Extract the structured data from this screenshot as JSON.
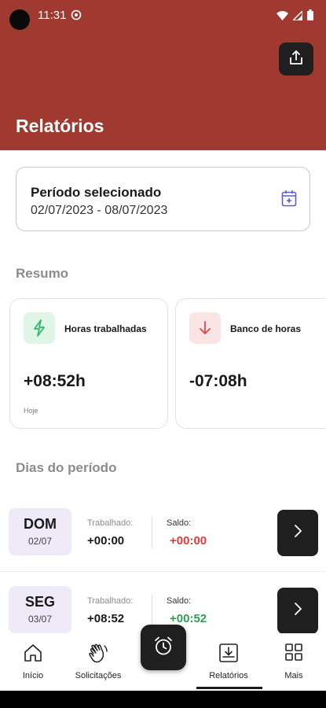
{
  "status_bar": {
    "time": "11:31"
  },
  "header": {
    "title": "Relatórios"
  },
  "period": {
    "label": "Período selecionado",
    "value": "02/07/2023 - 08/07/2023"
  },
  "summary": {
    "title": "Resumo",
    "cards": [
      {
        "label": "Horas trabalhadas",
        "value": "+08:52h",
        "caption": "Hoje",
        "icon": "lightning-icon",
        "icon_bg": "#dff5e6",
        "icon_color": "#2fb86a"
      },
      {
        "label": "Banco de horas",
        "value": "-07:08h",
        "caption": "",
        "icon": "arrow-down-icon",
        "icon_bg": "#fbe4e4",
        "icon_color": "#e04848"
      }
    ]
  },
  "days": {
    "title": "Dias do período",
    "worked_label": "Trabalhado:",
    "balance_label": "Saldo:",
    "rows": [
      {
        "day": "DOM",
        "date": "02/07",
        "worked": "+00:00",
        "balance": "+00:00",
        "balance_color": "#e53935"
      },
      {
        "day": "SEG",
        "date": "03/07",
        "worked": "+08:52",
        "balance": "+00:52",
        "balance_color": "#2e9e4f"
      }
    ]
  },
  "nav": {
    "items": [
      {
        "label": "Início",
        "icon": "home-icon"
      },
      {
        "label": "Solicitações",
        "icon": "hand-wave-icon"
      },
      {
        "label": "Relatórios",
        "icon": "download-tray-icon"
      },
      {
        "label": "Mais",
        "icon": "grid-icon"
      }
    ],
    "fab_icon": "alarm-clock-icon"
  },
  "colors": {
    "brand": "#a03a30",
    "dark_button": "#1f1f1f",
    "positive": "#2e9e4f",
    "negative": "#e53935"
  }
}
